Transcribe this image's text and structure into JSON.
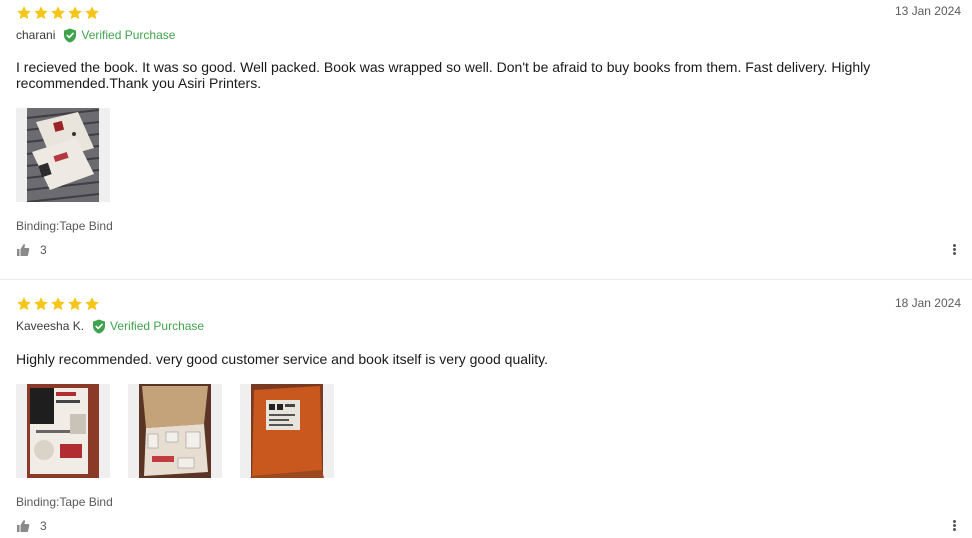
{
  "reviews": [
    {
      "rating": 5,
      "date": "13 Jan 2024",
      "author": "charani",
      "verified_label": "Verified Purchase",
      "text": "I recieved the book. It was so good. Well packed. Book was wrapped so well. Don't be afraid to buy books from them. Fast delivery. Highly recommended.Thank you Asiri Printers.",
      "photo_count": 1,
      "binding": "Binding:Tape Bind",
      "likes": "3"
    },
    {
      "rating": 5,
      "date": "18 Jan 2024",
      "author": "Kaveesha K.",
      "verified_label": "Verified Purchase",
      "text": "Highly recommended. very good customer service and book itself is very good quality.",
      "photo_count": 3,
      "binding": "Binding:Tape Bind",
      "likes": "3"
    }
  ],
  "icons": {
    "star": "star-icon",
    "verified": "verified-shield-icon",
    "like": "thumbs-up-icon",
    "more": "more-vertical-icon"
  },
  "colors": {
    "star": "#f5c518",
    "verified": "#3fa34d"
  }
}
